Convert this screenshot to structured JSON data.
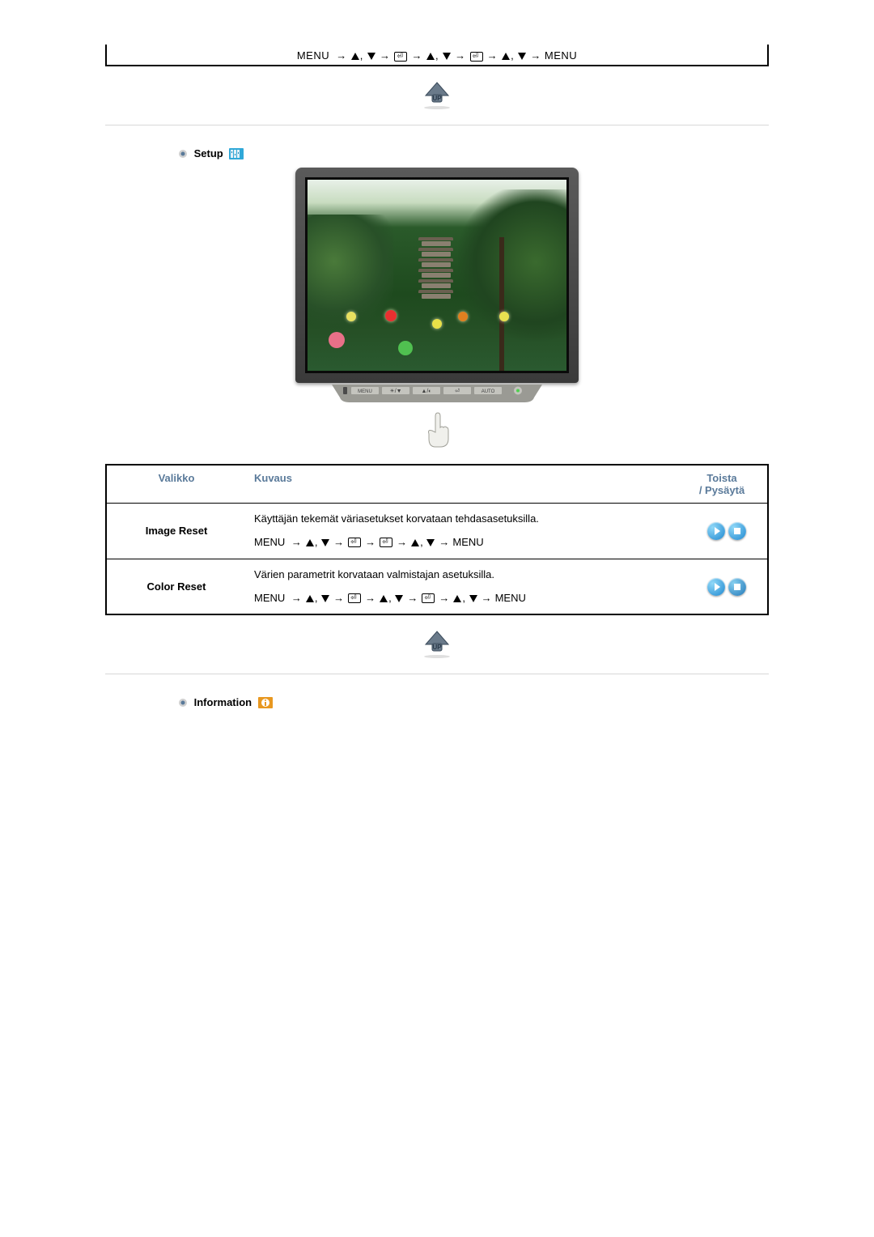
{
  "nav_line_top": {
    "tokens": [
      "MENU",
      "→",
      "UP",
      ",",
      "DOWN",
      "→",
      "ENTER",
      "→",
      "UP",
      ",",
      "DOWN",
      "→",
      "ENTER",
      "→",
      "UP",
      ",",
      "DOWN",
      "→",
      "MENU"
    ]
  },
  "sections": {
    "setup": {
      "title": "Setup"
    },
    "information": {
      "title": "Information"
    }
  },
  "table": {
    "headers": {
      "menu": "Valikko",
      "desc": "Kuvaus",
      "play": "Toista\n/ Pysäytä"
    },
    "rows": [
      {
        "menu": "Image Reset",
        "desc": "Käyttäjän tekemät väriasetukset korvataan tehdasasetuksilla.",
        "nav_tokens": [
          "MENU",
          "→",
          "UP",
          ",",
          "DOWN",
          "→",
          "ENTER",
          "→",
          "ENTER",
          "→",
          "UP",
          ",",
          "DOWN",
          "→",
          "MENU"
        ]
      },
      {
        "menu": "Color Reset",
        "desc": "Värien parametrit korvataan valmistajan asetuksilla.",
        "nav_tokens": [
          "MENU",
          "→",
          "UP",
          ",",
          "DOWN",
          "→",
          "ENTER",
          "→",
          "UP",
          ",",
          "DOWN",
          "→",
          "ENTER",
          "→",
          "UP",
          ",",
          "DOWN",
          "→",
          "MENU"
        ]
      }
    ]
  },
  "icon_labels": {
    "up_button": "UP",
    "monitor_btns": [
      "MENU",
      "",
      "",
      "",
      "AUTO",
      ""
    ]
  }
}
